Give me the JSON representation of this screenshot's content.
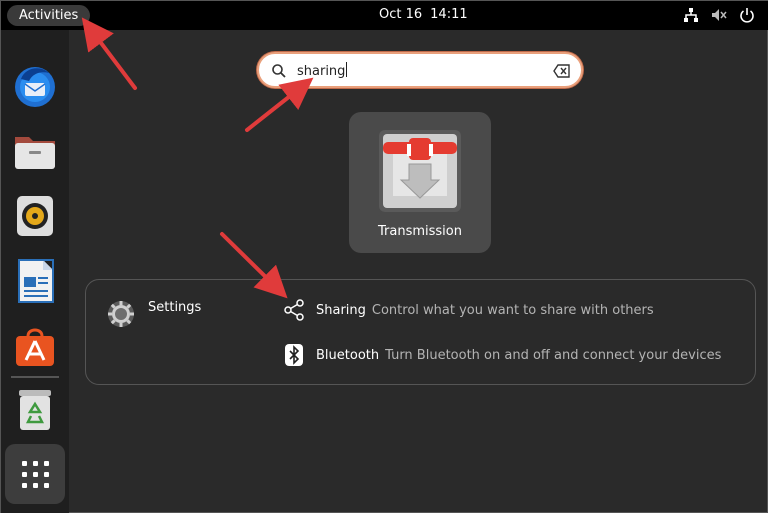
{
  "topbar": {
    "activities_label": "Activities",
    "date": "Oct 16",
    "time": "14:11",
    "tray_icons": [
      "network-icon",
      "volume-muted-icon",
      "power-icon"
    ]
  },
  "dock": {
    "items": [
      "thunderbird-icon",
      "files-icon",
      "rhythmbox-icon",
      "writer-icon",
      "software-icon",
      "trash-icon"
    ],
    "show_apps_icon": "app-grid-icon"
  },
  "search": {
    "value": "sharing",
    "icons": [
      "search-icon",
      "clear-icon"
    ]
  },
  "app_results": [
    {
      "label": "Transmission",
      "icon": "transmission-icon"
    }
  ],
  "settings_results": {
    "provider": "Settings",
    "provider_icon": "settings-gear-icon",
    "rows": [
      {
        "title": "Sharing",
        "description": "Control what you want to share with others",
        "icon": "share-icon"
      },
      {
        "title": "Bluetooth",
        "description": "Turn Bluetooth on and off and connect your devices",
        "icon": "bluetooth-icon"
      }
    ]
  },
  "colors": {
    "accent": "#e95420",
    "arrow": "#e03b3b",
    "search_focus": "#e9a07c"
  }
}
